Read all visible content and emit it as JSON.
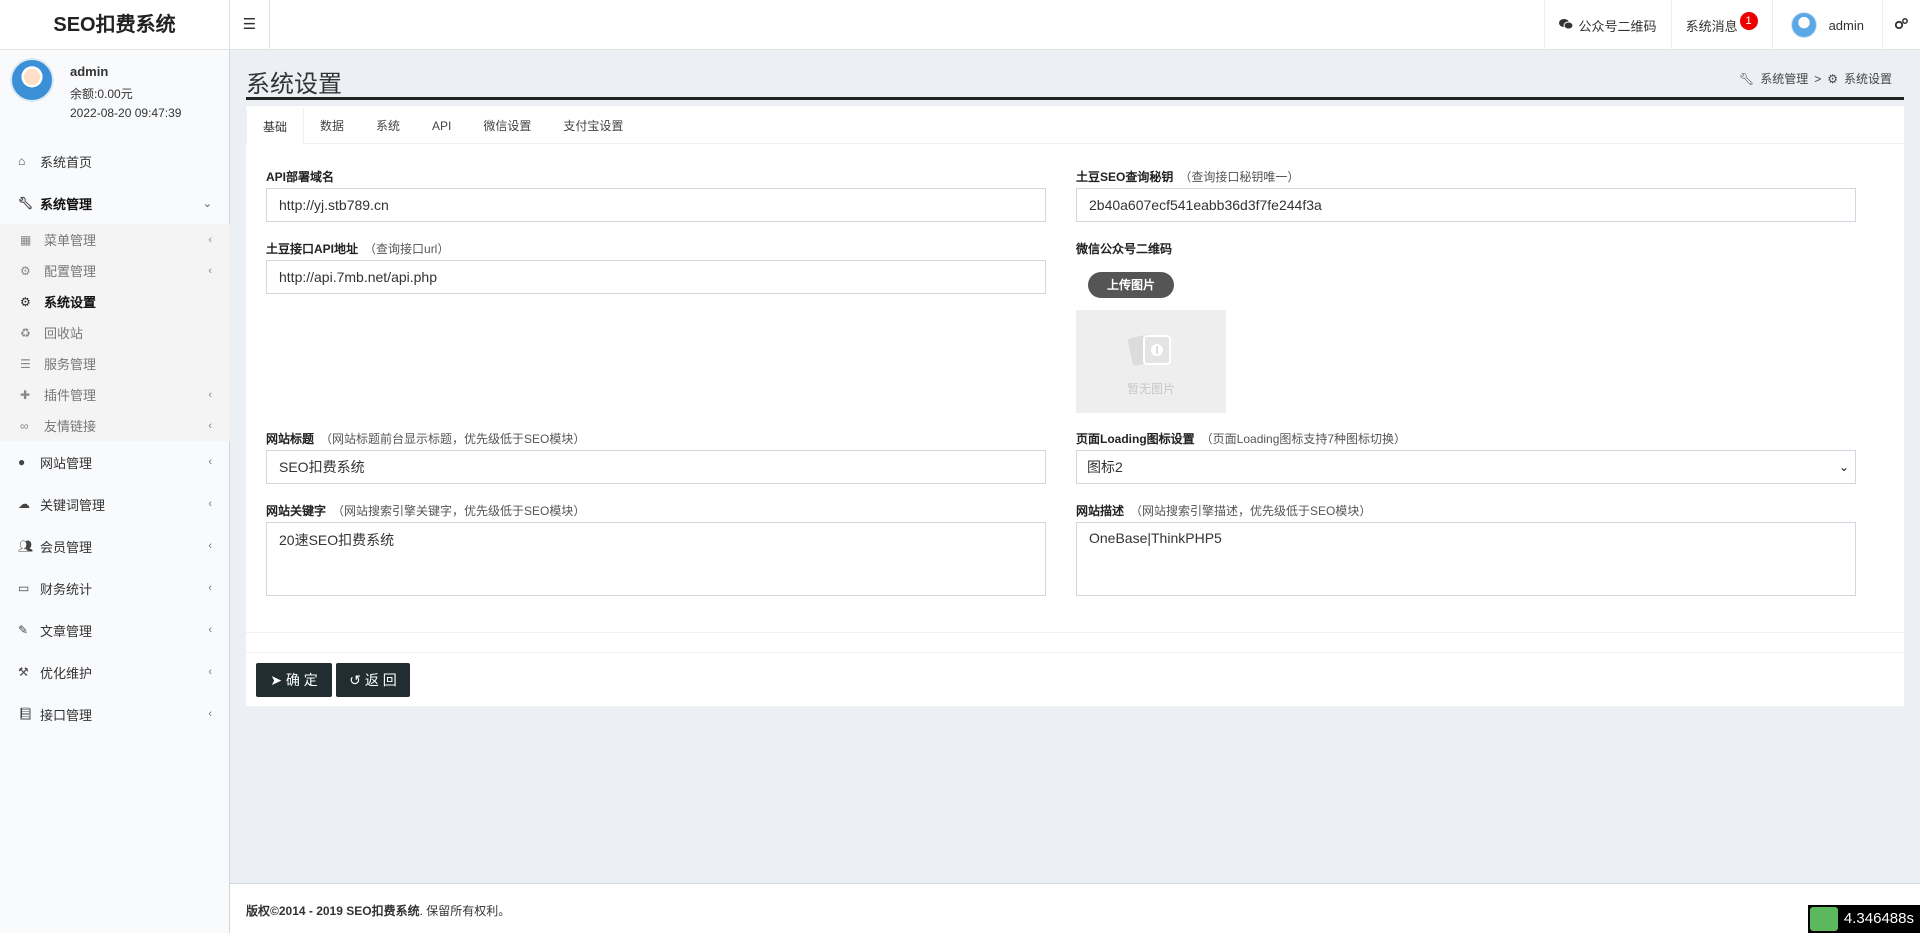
{
  "app": {
    "title": "SEO扣费系统"
  },
  "topnav": {
    "qrcode": "公众号二维码",
    "messages": "系统消息",
    "message_count": "1",
    "user": "admin"
  },
  "user_panel": {
    "name": "admin",
    "balance": "余额:0.00元",
    "time": "2022-08-20 09:47:39"
  },
  "sidebar": {
    "items": [
      {
        "label": "系统首页",
        "icon": "home-icon"
      },
      {
        "label": "系统管理",
        "icon": "wrench-icon"
      },
      {
        "label": "网站管理",
        "icon": "circle-icon"
      },
      {
        "label": "关键词管理",
        "icon": "cloud-icon"
      },
      {
        "label": "会员管理",
        "icon": "users-icon"
      },
      {
        "label": "财务统计",
        "icon": "card-icon"
      },
      {
        "label": "文章管理",
        "icon": "edit-icon"
      },
      {
        "label": "优化维护",
        "icon": "gavel-icon"
      },
      {
        "label": "接口管理",
        "icon": "book-icon"
      }
    ],
    "sub_items": [
      {
        "label": "菜单管理",
        "icon": "grid-icon"
      },
      {
        "label": "配置管理",
        "icon": "gear-icon"
      },
      {
        "label": "系统设置",
        "icon": "gears-icon"
      },
      {
        "label": "回收站",
        "icon": "recycle-icon"
      },
      {
        "label": "服务管理",
        "icon": "server-icon"
      },
      {
        "label": "插件管理",
        "icon": "puzzle-icon"
      },
      {
        "label": "友情链接",
        "icon": "link-icon"
      }
    ]
  },
  "page": {
    "title": "系统设置",
    "breadcrumb": {
      "parent": "系统管理",
      "sep": ">",
      "current": "系统设置"
    }
  },
  "tabs": [
    "基础",
    "数据",
    "系统",
    "API",
    "微信设置",
    "支付宝设置"
  ],
  "form": {
    "api_domain": {
      "label": "API部署域名",
      "value": "http://yj.stb789.cn"
    },
    "tudou_key": {
      "label": "土豆SEO查询秘钥",
      "hint": "（查询接口秘钥唯一）",
      "value": "2b40a607ecf541eabb36d3f7fe244f3a"
    },
    "tudou_api": {
      "label": "土豆接口API地址",
      "hint": "（查询接口url）",
      "value": "http://api.7mb.net/api.php"
    },
    "wechat_qr": {
      "label": "微信公众号二维码",
      "upload": "上传图片",
      "no_image": "暂无图片"
    },
    "site_title": {
      "label": "网站标题",
      "hint": "（网站标题前台显示标题，优先级低于SEO模块）",
      "value": "SEO扣费系统"
    },
    "loading_icon": {
      "label": "页面Loading图标设置",
      "hint": "（页面Loading图标支持7种图标切换）",
      "value": "图标2"
    },
    "site_keywords": {
      "label": "网站关键字",
      "hint": "（网站搜索引擎关键字，优先级低于SEO模块）",
      "value": "20速SEO扣费系统"
    },
    "site_desc": {
      "label": "网站描述",
      "hint": "（网站搜索引擎描述，优先级低于SEO模块）",
      "value": "OneBase|ThinkPHP5"
    }
  },
  "buttons": {
    "confirm": "确 定",
    "back": "返 回"
  },
  "footer": {
    "copyright": "版权©2014 - 2019",
    "brand": "SEO扣费系统",
    "rest": ". 保留所有权利。"
  },
  "timer": "4.346488s"
}
